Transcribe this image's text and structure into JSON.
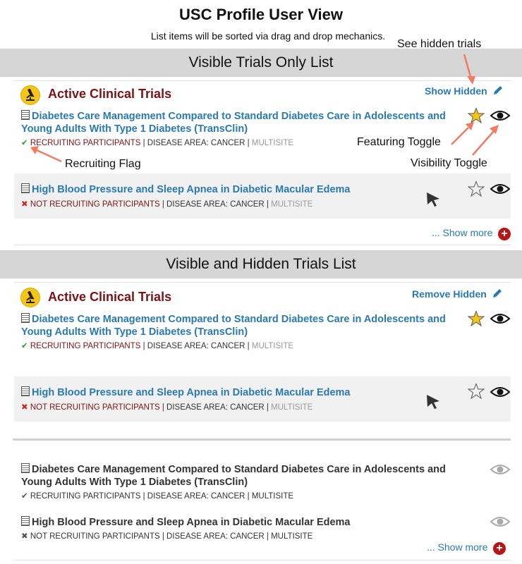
{
  "page": {
    "title": "USC Profile User View",
    "subtitle": "List items will be sorted via drag and drop mechanics."
  },
  "annotations": {
    "see_hidden": "See hidden trials",
    "featuring_toggle": "Featuring Toggle",
    "visibility_toggle": "Visibility Toggle",
    "recruiting_flag": "Recruiting Flag"
  },
  "section1": {
    "band_title": "Visible Trials Only List",
    "heading": "Active Clinical Trials",
    "toggle_label": "Show Hidden",
    "trials": [
      {
        "title_line1": "Diabetes Care Management Compared to Standard Diabetes Care in Adolescents and",
        "title_line2": "Young Adults With Type 1 Diabetes (TransClin)",
        "status_icon": "✔",
        "status": "RECRUITING PARTICIPANTS",
        "sep1": " | ",
        "disease": "DISEASE AREA: CANCER",
        "sep2": " | ",
        "site": "MULTISITE"
      },
      {
        "title_line1": "High Blood Pressure and Sleep Apnea in Diabetic Macular Edema",
        "status_icon": "✖",
        "status": "NOT RECRUITING PARTICIPANTS",
        "sep1": " | ",
        "disease": "DISEASE AREA: CANCER",
        "sep2": " | ",
        "site": "MULTISITE"
      }
    ],
    "show_more": "... Show more"
  },
  "section2": {
    "band_title": "Visible and Hidden Trials List",
    "heading": "Active Clinical Trials",
    "toggle_label": "Remove Hidden",
    "trials": [
      {
        "title_line1": "Diabetes Care Management Compared to Standard Diabetes Care in Adolescents and",
        "title_line2": "Young Adults With Type 1 Diabetes (TransClin)",
        "status_icon": "✔",
        "status": "RECRUITING PARTICIPANTS",
        "sep1": " | ",
        "disease": "DISEASE AREA: CANCER",
        "sep2": " | ",
        "site": "MULTISITE"
      },
      {
        "title_line1": "High Blood Pressure and Sleep Apnea in Diabetic Macular Edema",
        "status_icon": "✖",
        "status": "NOT RECRUITING PARTICIPANTS",
        "sep1": " | ",
        "disease": "DISEASE AREA: CANCER",
        "sep2": " | ",
        "site": "MULTISITE"
      }
    ],
    "hidden_trials": [
      {
        "title_line1": "Diabetes Care Management Compared to Standard Diabetes Care in Adolescents and",
        "title_line2": "Young Adults With Type 1 Diabetes (TransClin)",
        "status_icon": "✔",
        "meta": "RECRUITING PARTICIPANTS | DISEASE AREA: CANCER | MULTISITE"
      },
      {
        "title_line1": "High Blood Pressure and Sleep Apnea in Diabetic Macular Edema",
        "status_icon": "✖",
        "meta": "NOT RECRUITING PARTICIPANTS | DISEASE AREA: CANCER | MULTISITE"
      }
    ],
    "show_more": "... Show more"
  },
  "colors": {
    "accent_blue": "#2a7ab2",
    "heading_red": "#7b1315",
    "star_gold": "#f5c518",
    "arrow_salmon": "#f07b62",
    "band_gray": "#d6d6d6"
  },
  "icons": [
    "microscope-icon",
    "pencil-icon",
    "document-icon",
    "star-icon",
    "eye-icon",
    "cursor-icon",
    "plus-icon",
    "check-icon",
    "x-icon"
  ]
}
